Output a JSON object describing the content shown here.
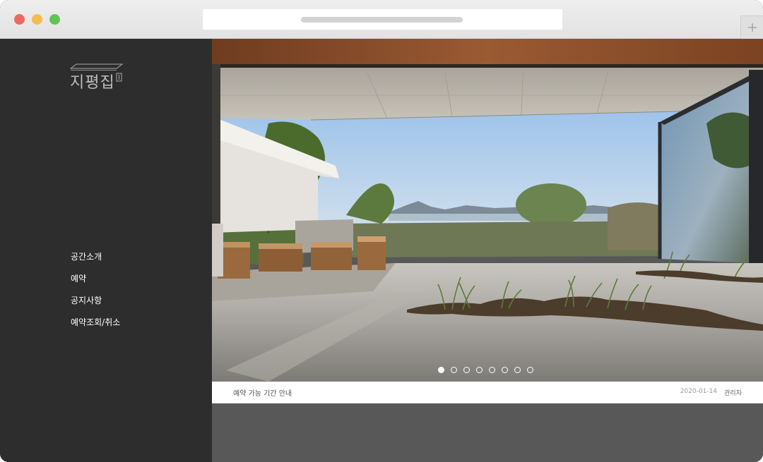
{
  "brand": {
    "logo_text": "지평집"
  },
  "nav": {
    "items": [
      {
        "label": "공간소개"
      },
      {
        "label": "예약"
      },
      {
        "label": "공지사항"
      },
      {
        "label": "예약조회/취소"
      }
    ]
  },
  "slider": {
    "count": 8,
    "active_index": 0
  },
  "notice": {
    "title": "예약 가능 기간 안내",
    "date": "2020-01-14",
    "author": "관리자"
  },
  "colors": {
    "sidebar": "#2d2d2d",
    "main_bg": "#585858",
    "wood": "#8a4f2c",
    "concrete": "#b9b4ab",
    "sky": "#b9d3ec"
  }
}
